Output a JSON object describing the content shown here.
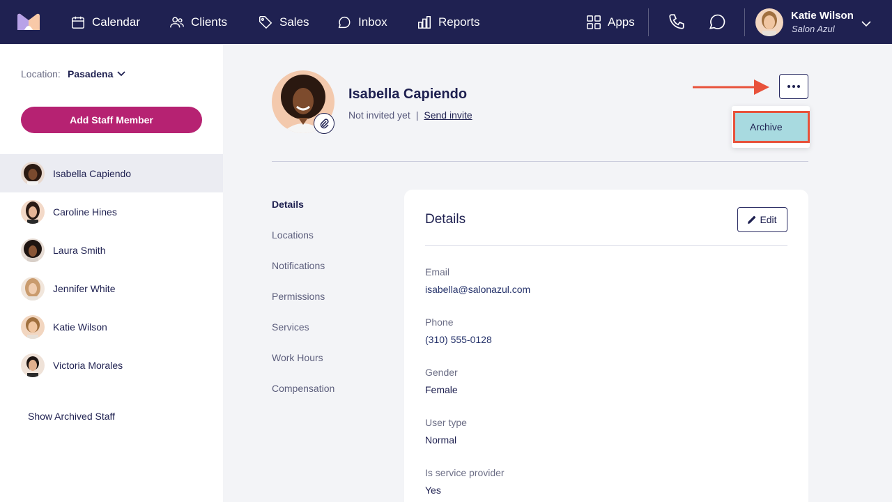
{
  "nav": {
    "items": [
      {
        "label": "Calendar",
        "icon": "calendar-icon"
      },
      {
        "label": "Clients",
        "icon": "users-icon"
      },
      {
        "label": "Sales",
        "icon": "tag-icon"
      },
      {
        "label": "Inbox",
        "icon": "chat-bubble-icon"
      },
      {
        "label": "Reports",
        "icon": "bar-chart-icon"
      }
    ],
    "apps_label": "Apps",
    "user": {
      "name": "Katie Wilson",
      "org": "Salon Azul"
    }
  },
  "sidebar": {
    "location_label": "Location:",
    "location_value": "Pasadena",
    "add_button": "Add Staff Member",
    "staff": [
      {
        "name": "Isabella Capiendo",
        "active": true
      },
      {
        "name": "Caroline Hines"
      },
      {
        "name": "Laura Smith"
      },
      {
        "name": "Jennifer White"
      },
      {
        "name": "Katie Wilson"
      },
      {
        "name": "Victoria Morales"
      }
    ],
    "show_archived": "Show Archived Staff"
  },
  "profile": {
    "name": "Isabella Capiendo",
    "status": "Not invited yet",
    "separator": "|",
    "send_invite": "Send invite"
  },
  "more_menu": {
    "items": [
      "Archive"
    ]
  },
  "subnav": [
    "Details",
    "Locations",
    "Notifications",
    "Permissions",
    "Services",
    "Work Hours",
    "Compensation"
  ],
  "details": {
    "title": "Details",
    "edit_label": "Edit",
    "fields": [
      {
        "label": "Email",
        "value": "isabella@salonazul.com"
      },
      {
        "label": "Phone",
        "value": "(310) 555-0128"
      },
      {
        "label": "Gender",
        "value": "Female"
      },
      {
        "label": "User type",
        "value": "Normal"
      },
      {
        "label": "Is service provider",
        "value": "Yes"
      }
    ]
  },
  "colors": {
    "nav_bg": "#1f2151",
    "accent": "#b62272",
    "highlight": "#e8523b",
    "menu_item_bg": "#a8dae0"
  }
}
